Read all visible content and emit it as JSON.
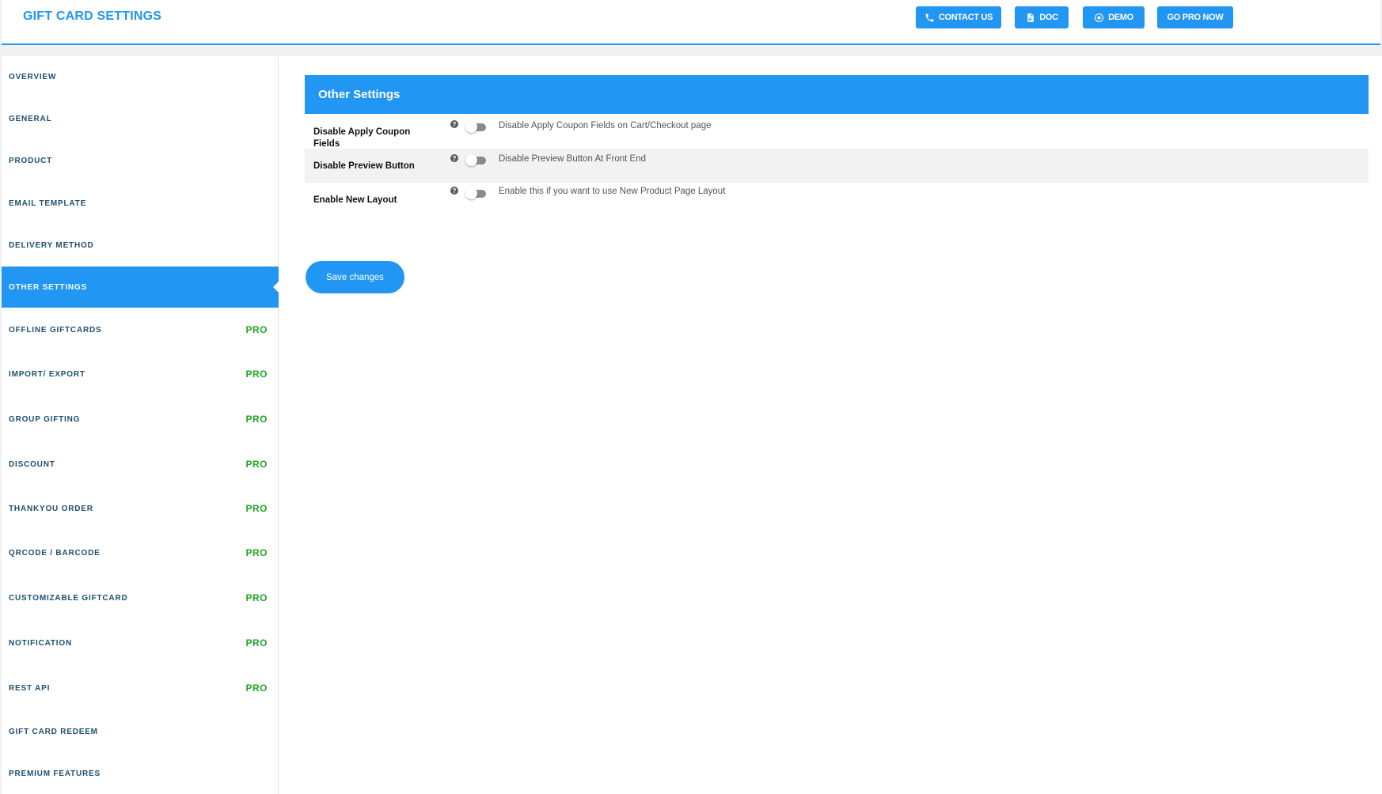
{
  "header": {
    "title": "GIFT CARD SETTINGS",
    "buttons": {
      "contact": "CONTACT US",
      "doc": "DOC",
      "demo": "DEMO",
      "gopro": "GO PRO NOW"
    }
  },
  "sidebar": {
    "pro_label": "PRO",
    "items": [
      {
        "label": "OVERVIEW"
      },
      {
        "label": "GENERAL"
      },
      {
        "label": "PRODUCT"
      },
      {
        "label": "EMAIL TEMPLATE"
      },
      {
        "label": "DELIVERY METHOD"
      },
      {
        "label": "OTHER SETTINGS",
        "active": true
      },
      {
        "label": "OFFLINE GIFTCARDS",
        "pro": true
      },
      {
        "label": "IMPORT/ EXPORT",
        "pro": true
      },
      {
        "label": "GROUP GIFTING",
        "pro": true
      },
      {
        "label": "DISCOUNT",
        "pro": true
      },
      {
        "label": "THANKYOU ORDER",
        "pro": true
      },
      {
        "label": "QRCODE / BARCODE",
        "pro": true
      },
      {
        "label": "CUSTOMIZABLE GIFTCARD",
        "pro": true
      },
      {
        "label": "NOTIFICATION",
        "pro": true
      },
      {
        "label": "REST API",
        "pro": true
      },
      {
        "label": "GIFT CARD REDEEM"
      },
      {
        "label": "PREMIUM FEATURES"
      }
    ]
  },
  "main": {
    "section_title": "Other Settings",
    "help_glyph": "?",
    "settings": [
      {
        "label": "Disable Apply Coupon Fields",
        "description": "Disable Apply Coupon Fields on Cart/Checkout page",
        "enabled": false
      },
      {
        "label": "Disable Preview Button",
        "description": "Disable Preview Button At Front End",
        "enabled": false
      },
      {
        "label": "Enable New Layout",
        "description": "Enable this if you want to use New Product Page Layout",
        "enabled": false
      }
    ],
    "save_label": "Save changes"
  },
  "colors": {
    "accent": "#2196f3",
    "pro": "#21a626",
    "nav_text": "#1e4e6e"
  }
}
